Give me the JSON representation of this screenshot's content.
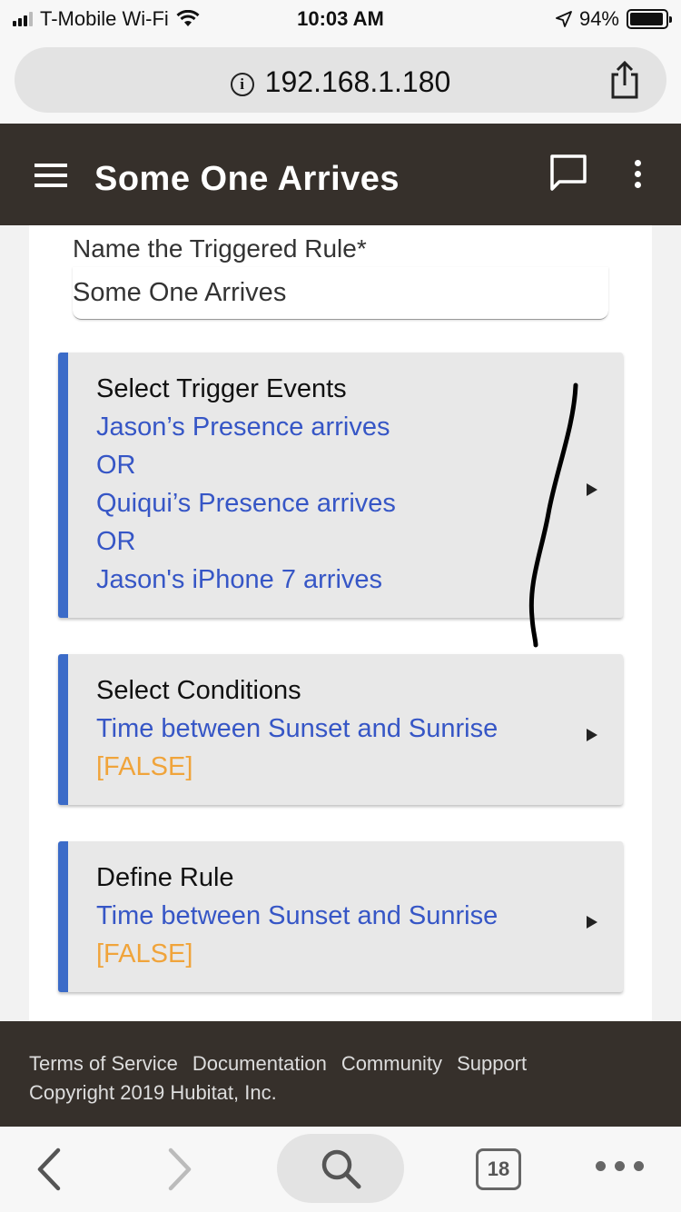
{
  "status_bar": {
    "carrier": "T-Mobile Wi-Fi",
    "time": "10:03 AM",
    "battery": "94%",
    "battery_level": 0.94
  },
  "browser": {
    "url": "192.168.1.180",
    "tab_count": "18"
  },
  "app_bar": {
    "title": "Some One Arrives",
    "icons": [
      "menu-icon",
      "chat-icon",
      "more-vert-icon"
    ]
  },
  "rule_name": {
    "label": "Name the Triggered Rule*",
    "value": "Some One Arrives"
  },
  "sections": {
    "triggers": {
      "title": "Select Trigger Events",
      "lines": [
        "Jason’s Presence arrives",
        "OR",
        "Quiqui’s Presence arrives",
        "OR",
        "Jason's iPhone 7 arrives"
      ]
    },
    "conditions": {
      "title": "Select Conditions",
      "detail": "Time between Sunset and Sunrise",
      "state": "[FALSE]"
    },
    "rule": {
      "title": "Define Rule",
      "detail": "Time between Sunset and Sunrise",
      "state": "[FALSE]"
    }
  },
  "footer": {
    "links": [
      "Terms of Service",
      "Documentation",
      "Community",
      "Support"
    ],
    "copyright": "Copyright 2019 Hubitat, Inc."
  },
  "colors": {
    "app_bar": "#36302b",
    "accent": "#3b6bc8",
    "link_text": "#3656c6",
    "false_text": "#f0a43b"
  }
}
